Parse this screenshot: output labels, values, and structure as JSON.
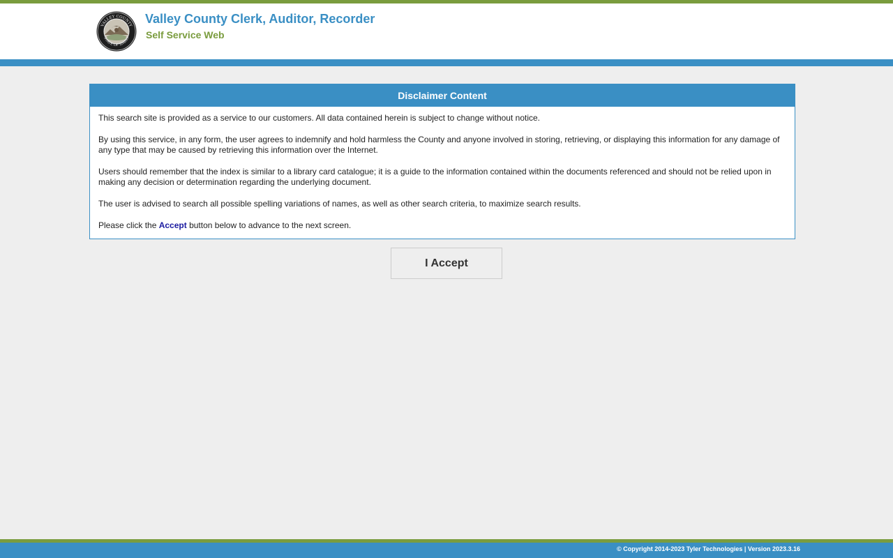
{
  "header": {
    "title": "Valley County Clerk, Auditor, Recorder",
    "subtitle": "Self Service Web",
    "seal": {
      "icon": "county-seal-logo",
      "text_top": "VALLEY COUNTY",
      "text_bottom": "STATE OF IDAHO"
    }
  },
  "disclaimer": {
    "heading": "Disclaimer Content",
    "paragraphs": [
      "This search site is provided as a service to our customers. All data contained herein is subject to change without notice.",
      "By using this service, in any form, the user agrees to indemnify and hold harmless the County and anyone involved in storing, retrieving, or displaying this information for any damage of any type that may be caused by retrieving this information over the Internet.",
      "Users should remember that the index is similar to a library card catalogue; it is a guide to the information contained within the documents referenced and should not be relied upon in making any decision or determination regarding the underlying document.",
      "The user is advised to search all possible spelling variations of names, as well as other search criteria, to maximize search results."
    ],
    "instruction_prefix": "Please click the ",
    "instruction_link": "Accept",
    "instruction_suffix": " button below to advance to the next screen."
  },
  "accept_button": {
    "label": "I Accept"
  },
  "footer": {
    "text": "© Copyright 2014-2023 Tyler Technologies | Version 2023.3.16"
  },
  "colors": {
    "brand_blue": "#3a8fc4",
    "brand_green": "#7a9c3e",
    "background": "#eeeeee"
  }
}
